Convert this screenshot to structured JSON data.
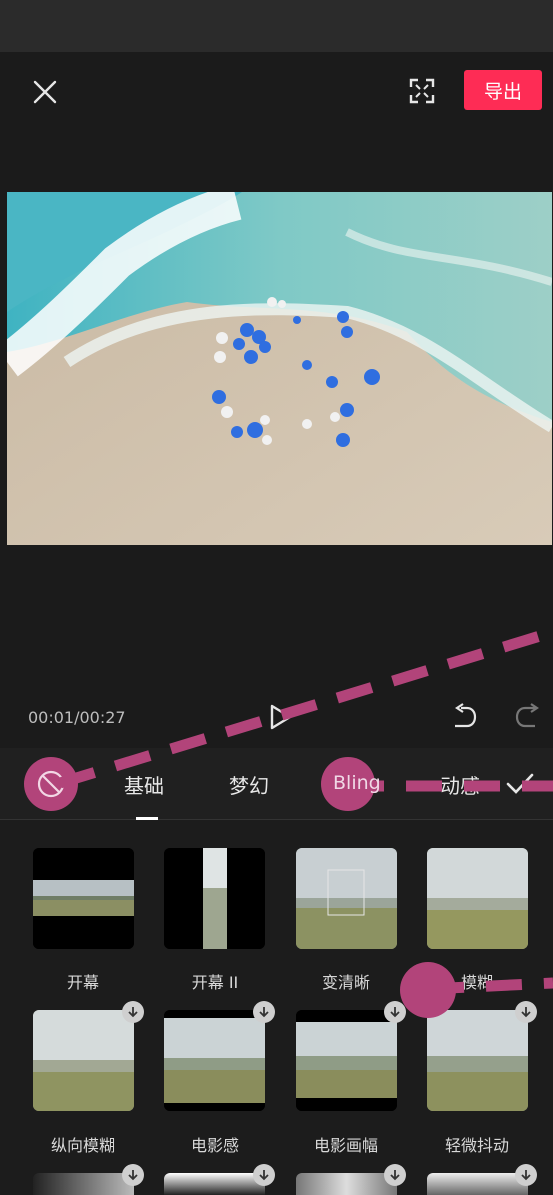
{
  "header": {
    "export_label": "导出"
  },
  "player": {
    "time": "00:01/00:27"
  },
  "tabs": [
    "基础",
    "梦幻",
    "Bling",
    "动感"
  ],
  "effects": [
    {
      "label": "开幕"
    },
    {
      "label": "开幕 II"
    },
    {
      "label": "变清晰"
    },
    {
      "label": "模糊"
    },
    {
      "label": "纵向模糊"
    },
    {
      "label": "电影感"
    },
    {
      "label": "电影画幅"
    },
    {
      "label": "轻微抖动"
    }
  ],
  "icons": {
    "close": "close-icon",
    "fullscreen": "fullscreen-icon",
    "play": "play-icon",
    "undo": "undo-icon",
    "redo": "redo-icon",
    "none": "no-effect-icon",
    "confirm": "check-icon",
    "download": "download-icon"
  },
  "colors": {
    "accent": "#fe2c55",
    "annotation": "#b2447a"
  }
}
